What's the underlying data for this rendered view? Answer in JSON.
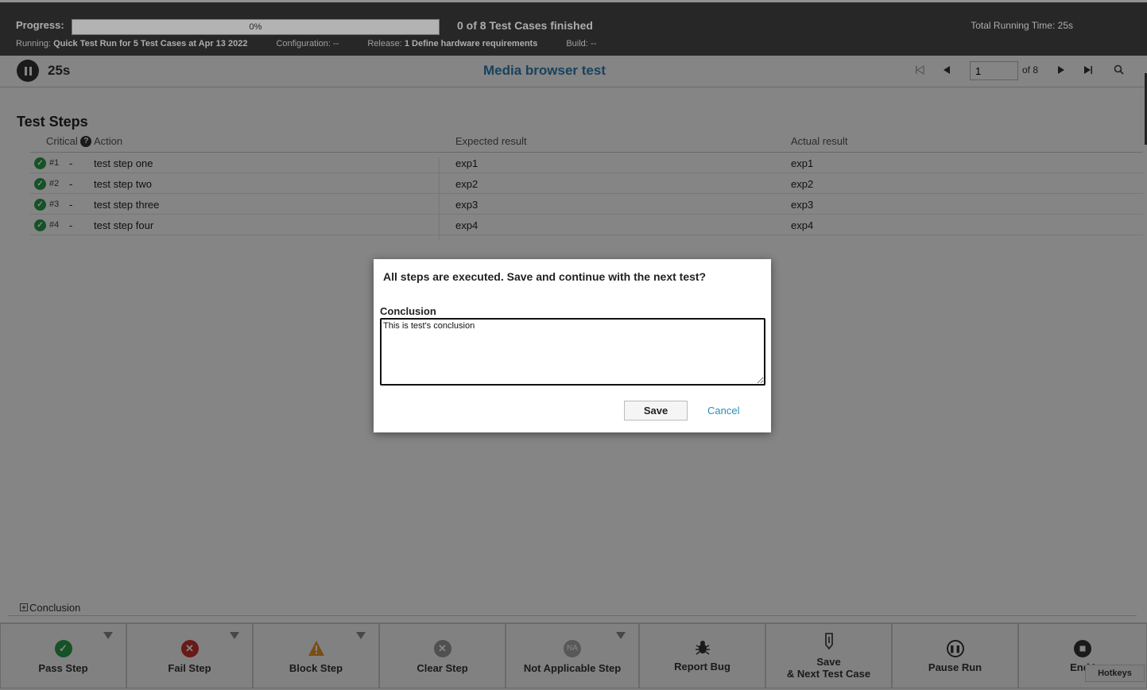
{
  "header": {
    "progress_label": "Progress:",
    "progress_percent": 0,
    "progress_text": "0%",
    "finished_text": "0 of 8 Test Cases finished",
    "total_time": "Total Running Time: 25s",
    "running_label": "Running:",
    "running_value": "Quick Test Run for 5 Test Cases at Apr 13 2022",
    "configuration_label": "Configuration:",
    "configuration_value": "--",
    "release_label": "Release:",
    "release_value": "1 Define hardware requirements",
    "build_label": "Build:",
    "build_value": "--"
  },
  "toolbar": {
    "timer": "25s",
    "test_title": "Media browser test",
    "page_value": "1",
    "page_of": "of 8"
  },
  "steps": {
    "title": "Test Steps",
    "columns": {
      "critical": "Critical",
      "action": "Action",
      "expected": "Expected result",
      "actual": "Actual result"
    },
    "rows": [
      {
        "num": "#1",
        "critical": "-",
        "action": "test step one",
        "expected": "exp1",
        "actual": "exp1"
      },
      {
        "num": "#2",
        "critical": "-",
        "action": "test step two",
        "expected": "exp2",
        "actual": "exp2"
      },
      {
        "num": "#3",
        "critical": "-",
        "action": "test step three",
        "expected": "exp3",
        "actual": "exp3"
      },
      {
        "num": "#4",
        "critical": "-",
        "action": "test step four",
        "expected": "exp4",
        "actual": "exp4"
      }
    ]
  },
  "conclusion_section": {
    "label": "Conclusion"
  },
  "footer": {
    "pass": "Pass Step",
    "fail": "Fail Step",
    "block": "Block Step",
    "clear": "Clear Step",
    "na": "Not Applicable Step",
    "na_icon_text": "NA",
    "report": "Report Bug",
    "save_next_1": "Save",
    "save_next_2": "& Next Test Case",
    "pause": "Pause Run",
    "end": "End I",
    "hotkeys": "Hotkeys"
  },
  "dialog": {
    "message": "All steps are executed. Save and continue with the next test?",
    "conclusion_label": "Conclusion",
    "conclusion_value": "This is test's conclusion",
    "save": "Save",
    "cancel": "Cancel"
  },
  "colors": {
    "header_bg": "#333333",
    "title_blue": "#2f7fb5",
    "pass_green": "#2a9d4a",
    "fail_red": "#c9302c",
    "block_orange": "#e8962a",
    "clear_grey": "#999999",
    "link_blue": "#2a8fb8"
  }
}
